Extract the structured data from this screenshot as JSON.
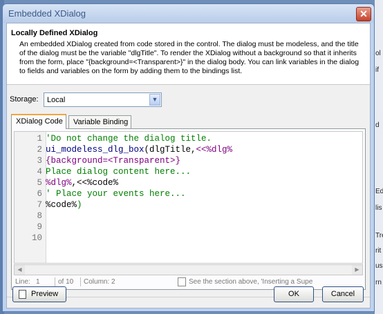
{
  "window": {
    "title": "Embedded XDialog",
    "close_glyph": "✕"
  },
  "header": {
    "title": "Locally Defined XDialog",
    "description": "An embedded XDialog created from code stored in the control. The dialog must be modeless, and the title of the dialog must be the variable \"dlgTitle\". To render the XDialog without a background so that it inherits from the form, place \"{background=<Transparent>}\" in the dialog body. You can link variables in the dialog to fields and variables on the form by adding them to the bindings list."
  },
  "storage": {
    "label": "Storage:",
    "value": "Local"
  },
  "tabs": [
    {
      "label": "XDialog Code",
      "active": true
    },
    {
      "label": "Variable Binding",
      "active": false
    }
  ],
  "editor": {
    "lines": [
      {
        "num": "1",
        "segments": [
          {
            "text": "'Do not change the dialog title.",
            "kind": "comment"
          }
        ]
      },
      {
        "num": "2",
        "segments": [
          {
            "text": "ui_modeless_dlg_box",
            "kind": "func"
          },
          {
            "text": "(dlgTitle,",
            "kind": "plain"
          },
          {
            "text": "<<%dlg%",
            "kind": "str"
          }
        ]
      },
      {
        "num": "3",
        "segments": [
          {
            "text": "{background=<Transparent>}",
            "kind": "str"
          }
        ]
      },
      {
        "num": "4",
        "segments": [
          {
            "text": "Place dialog content here...",
            "kind": "comment"
          }
        ]
      },
      {
        "num": "5",
        "segments": [
          {
            "text": "%dlg%",
            "kind": "str"
          },
          {
            "text": ",",
            "kind": "plain"
          },
          {
            "text": "<<%code%",
            "kind": "plain"
          }
        ]
      },
      {
        "num": "6",
        "segments": [
          {
            "text": "' Place your events here...",
            "kind": "comment"
          }
        ]
      },
      {
        "num": "7",
        "segments": [
          {
            "text": "%code%",
            "kind": "plain"
          },
          {
            "text": ")",
            "kind": "comment"
          }
        ]
      },
      {
        "num": "8",
        "segments": []
      },
      {
        "num": "9",
        "segments": []
      },
      {
        "num": "10",
        "segments": []
      }
    ]
  },
  "status": {
    "line_label": "Line:",
    "line_value": "1",
    "of_total": "of 10",
    "column_label": "Column:",
    "column_value": "2",
    "hint": "See the section above, 'Inserting a Supe"
  },
  "buttons": {
    "preview": "Preview",
    "ok": "OK",
    "cancel": "Cancel"
  },
  "background": {
    "right_edge_fragments": [
      "ol",
      "if",
      "d",
      "Ed",
      "lis",
      "Tre",
      "rit",
      "us",
      "rn"
    ]
  },
  "colors": {
    "comment": "#008000",
    "func": "#000080",
    "str": "#800080",
    "tab_accent": "#f5a33a",
    "close": "#c6402a"
  }
}
